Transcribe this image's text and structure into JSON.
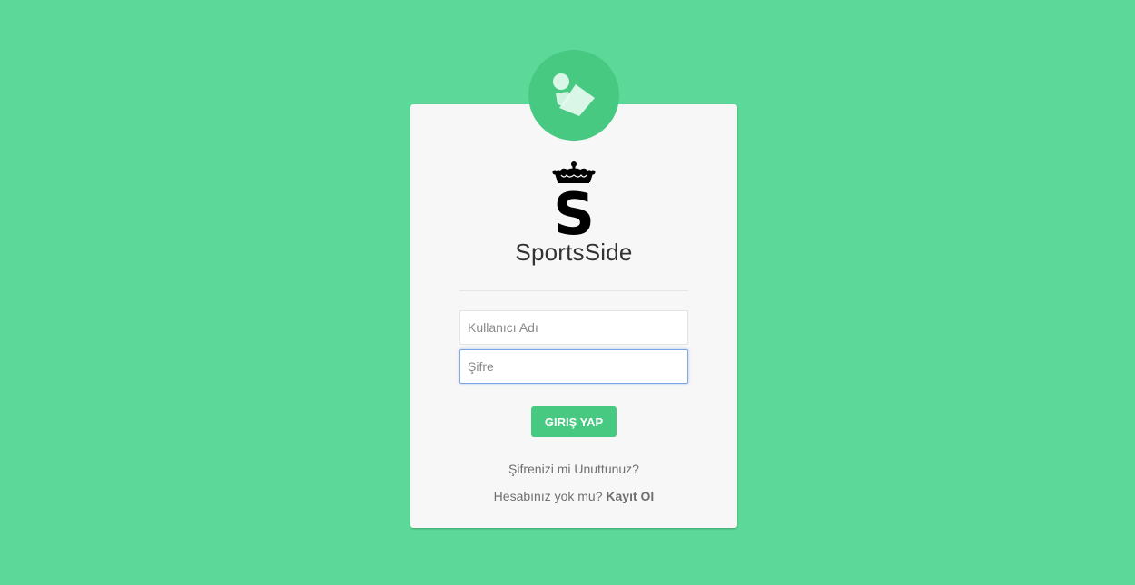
{
  "brand": {
    "name": "SportsSide",
    "logo_letter": "S"
  },
  "login": {
    "username_placeholder": "Kullanıcı Adı",
    "password_placeholder": "Şifre",
    "submit_label": "GIRIŞ YAP",
    "forgot_label": "Şifrenizi mi Unuttunuz?",
    "no_account_text": "Hesabınız yok mu?",
    "register_label": "Kayıt Ol"
  },
  "icons": {
    "avatar": "user-badge-icon",
    "logo": "crown-s-logo"
  },
  "colors": {
    "background": "#5cd998",
    "accent": "#47c982",
    "card": "#f7f7f7"
  }
}
